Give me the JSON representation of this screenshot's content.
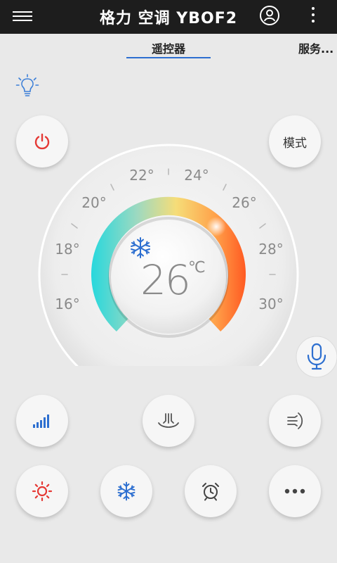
{
  "header": {
    "title": "格力 空调 YBOF2"
  },
  "tabs": {
    "remote": "遥控器",
    "service": "服务..."
  },
  "controls": {
    "mode_label": "模式"
  },
  "dial": {
    "current_temp": "26",
    "unit": "℃",
    "scale_labels": [
      "16°",
      "18°",
      "20°",
      "22°",
      "24°",
      "26°",
      "28°",
      "30°"
    ]
  },
  "icons": {
    "menu": "hamburger-icon",
    "user": "user-icon",
    "more": "more-vert-icon",
    "bulb": "lightbulb-icon",
    "power": "power-icon",
    "snow": "snowflake-icon",
    "mic": "microphone-icon",
    "fan": "fan-speed-icon",
    "airflow_down": "airflow-down-icon",
    "airflow_side": "airflow-side-icon",
    "heat": "sun-icon",
    "cool": "snowflake-icon",
    "timer": "alarm-clock-icon",
    "more_functions": "more-horizontal-icon"
  },
  "colors": {
    "power_red": "#e53935",
    "blue_accent": "#2d6fd0",
    "gauge_cyan": "#2fd6d9",
    "gauge_yellow": "#f5d66a",
    "gauge_orange": "#ff6a2a"
  }
}
